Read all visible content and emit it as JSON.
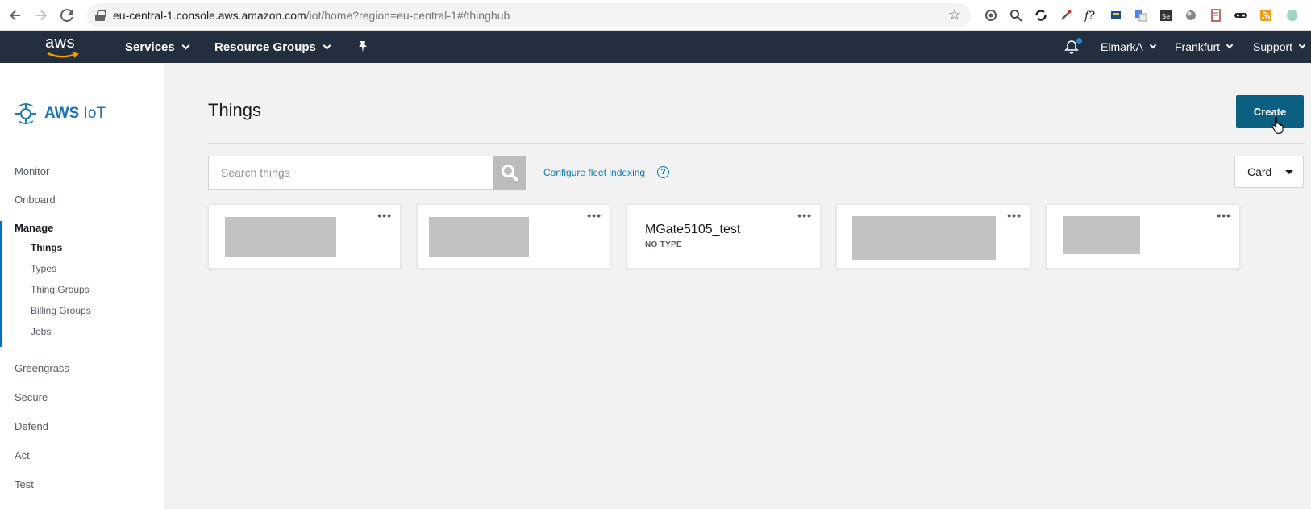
{
  "browser": {
    "url_host": "eu-central-1.console.aws.amazon.com",
    "url_path": "/iot/home?region=eu-central-1#/thinghub"
  },
  "header": {
    "logo_text": "aws",
    "services_label": "Services",
    "resource_groups_label": "Resource Groups",
    "account_label": "ElmarkA",
    "region_label": "Frankfurt",
    "support_label": "Support"
  },
  "sidebar": {
    "brand_bold": "AWS",
    "brand_rest": " IoT",
    "items": [
      {
        "label": "Monitor"
      },
      {
        "label": "Onboard"
      },
      {
        "label": "Manage"
      },
      {
        "label": "Greengrass"
      },
      {
        "label": "Secure"
      },
      {
        "label": "Defend"
      },
      {
        "label": "Act"
      },
      {
        "label": "Test"
      }
    ],
    "manage_sub": [
      {
        "label": "Things"
      },
      {
        "label": "Types"
      },
      {
        "label": "Thing Groups"
      },
      {
        "label": "Billing Groups"
      },
      {
        "label": "Jobs"
      }
    ]
  },
  "main": {
    "title": "Things",
    "create_label": "Create",
    "search_placeholder": "Search things",
    "config_link": "Configure fleet indexing",
    "help_glyph": "?",
    "view_label": "Card",
    "cards": [
      {
        "name": "",
        "type": "",
        "redacted": true
      },
      {
        "name": "",
        "type": "",
        "redacted": true
      },
      {
        "name": "MGate5105_test",
        "type": "NO TYPE",
        "redacted": false
      },
      {
        "name": "",
        "type": "",
        "redacted": true
      },
      {
        "name": "",
        "type": "",
        "redacted": true
      }
    ]
  },
  "colors": {
    "header_bg": "#232f3e",
    "create_bg": "#0b6082",
    "link": "#0b7bb5",
    "active_marker": "#0073bb"
  }
}
